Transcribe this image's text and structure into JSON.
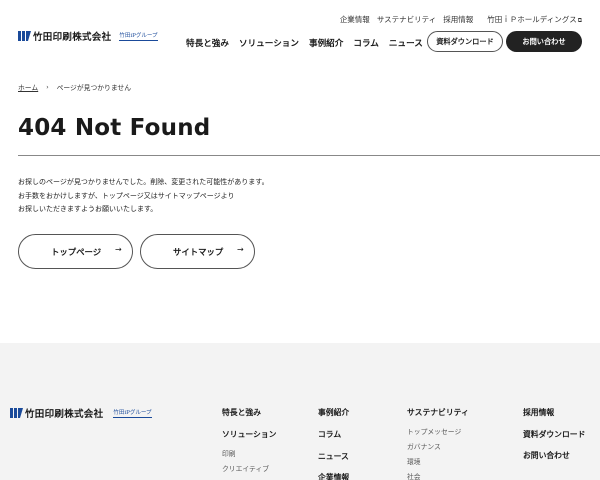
{
  "header": {
    "logo_name": "竹田印刷株式会社",
    "logo_group": "竹田iPグループ",
    "util_nav": [
      "企業情報",
      "サステナビリティ",
      "採用情報",
      "竹田ｉＰホールディングス"
    ],
    "main_nav": [
      "特長と強み",
      "ソリューション",
      "事例紹介",
      "コラム",
      "ニュース"
    ],
    "download_label": "資料ダウンロード",
    "contact_label": "お問い合わせ"
  },
  "breadcrumb": {
    "home": "ホーム",
    "separator": "›",
    "current": "ページが見つかりません"
  },
  "main": {
    "title": "404 Not Found",
    "message_lines": [
      "お探しのページが見つかりませんでした。削除、変更された可能性があります。",
      "お手数をおかけしますが、トップページ又はサイトマップページより",
      "お探しいただきますようお願いいたします。"
    ],
    "top_page_label": "トップページ",
    "sitemap_label": "サイトマップ",
    "arrow": "→"
  },
  "footer": {
    "logo_name": "竹田印刷株式会社",
    "logo_group": "竹田iPグループ",
    "col1": {
      "features": "特長と強み",
      "solutions": "ソリューション",
      "sub_items": [
        "印刷",
        "クリエイティブ"
      ]
    },
    "col2": {
      "cases": "事例紹介",
      "column": "コラム",
      "news": "ニュース",
      "company": "企業情報"
    },
    "col3": {
      "sustainability": "サステナビリティ",
      "sub_items": [
        "トップメッセージ",
        "ガバナンス",
        "環境",
        "社会"
      ]
    },
    "col4": {
      "recruit": "採用情報",
      "download": "資料ダウンロード",
      "contact": "お問い合わせ"
    }
  },
  "colors": {
    "accent_dark": "#222222",
    "logo_blue": "#1a4a9a",
    "footer_bg": "#f3f3f3"
  }
}
